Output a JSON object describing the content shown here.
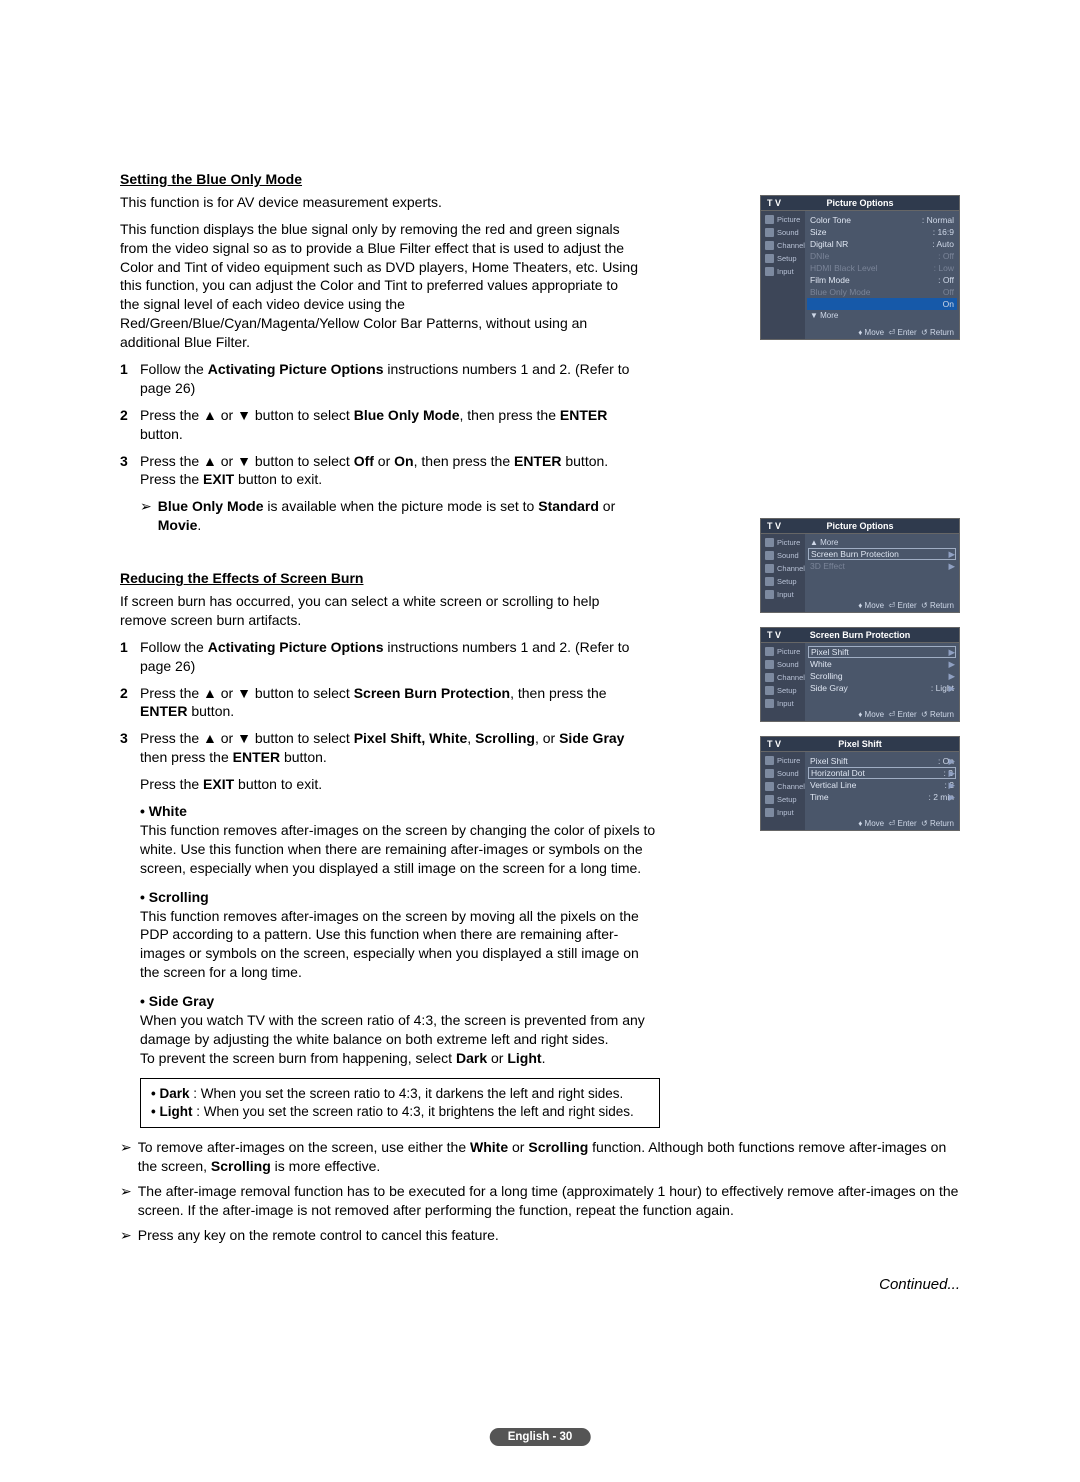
{
  "section1": {
    "title": "Setting the Blue Only Mode",
    "intro1": "This function is for AV device measurement experts.",
    "intro2": "This function displays the blue signal only by removing the red and green signals from the video signal so as to provide a Blue Filter effect that is used to adjust the Color and Tint of video equipment such as DVD players, Home Theaters, etc. Using this function, you can adjust the Color and Tint to preferred values appropriate to the signal level of each video device using the Red/Green/Blue/Cyan/Magenta/Yellow Color Bar Patterns, without using an additional Blue Filter.",
    "step1_a": "Follow the ",
    "step1_bold": "Activating Picture Options",
    "step1_b": " instructions numbers 1 and 2. (Refer to page 26)",
    "step2_a": "Press the ▲ or ▼ button to select ",
    "step2_bold1": "Blue Only Mode",
    "step2_b": ", then press the ",
    "step2_bold2": "ENTER",
    "step2_c": " button.",
    "step3_a": "Press the ▲ or ▼ button to select ",
    "step3_bold1": "Off",
    "step3_b": " or ",
    "step3_bold2": "On",
    "step3_c": ", then press the ",
    "step3_bold3": "ENTER",
    "step3_d": " button. Press the ",
    "step3_bold4": "EXIT",
    "step3_e": " button to exit.",
    "note_bold": "Blue Only Mode",
    "note_a": " is available when the picture mode is set to ",
    "note_bold2": "Standard",
    "note_b": " or ",
    "note_bold3": "Movie",
    "note_c": "."
  },
  "section2": {
    "title": "Reducing the Effects of Screen Burn",
    "intro": "If screen burn has occurred, you can select a white screen or scrolling to help remove screen burn artifacts.",
    "step1_a": "Follow the ",
    "step1_bold": "Activating Picture Options",
    "step1_b": " instructions numbers 1 and 2. (Refer to page 26)",
    "step2_a": "Press the ▲ or ▼ button to select ",
    "step2_bold1": "Screen Burn Protection",
    "step2_b": ", then press the ",
    "step2_bold2": "ENTER",
    "step2_c": " button.",
    "step3_a": "Press the ▲ or ▼ button to select ",
    "step3_bold1": "Pixel Shift, White",
    "step3_b": ", ",
    "step3_bold2": "Scrolling",
    "step3_c": ", or ",
    "step3_bold3": "Side Gray",
    "step3_d": " then press the ",
    "step3_bold4": "ENTER",
    "step3_e": " button.",
    "exit_a": "Press the ",
    "exit_bold": "EXIT",
    "exit_b": " button to exit.",
    "white_title": "• White",
    "white_body": "This function removes after-images on the screen by changing the color of pixels to white. Use this function when there are remaining after-images or symbols on the screen, especially when you displayed a still image on the screen for a long time.",
    "scroll_title": "• Scrolling",
    "scroll_body": "This function removes after-images on the screen by moving all the pixels on the PDP according to a pattern. Use this function when there are remaining after-images or symbols on the screen, especially when you displayed a still image on the screen for a long time.",
    "side_title": "• Side Gray",
    "side_body_a": "When you watch TV with the screen ratio of 4:3, the screen is prevented from any damage by adjusting the white balance on both extreme left and right sides.",
    "side_body_b_a": "To prevent the screen burn from happening, select ",
    "side_body_b_bold1": "Dark",
    "side_body_b_b": " or ",
    "side_body_b_bold2": "Light",
    "side_body_b_c": ".",
    "box1_bold": "• Dark",
    "box1_rest": " : When you set the screen ratio to 4:3, it darkens the left and right sides.",
    "box2_bold": "• Light",
    "box2_rest": " : When you set the screen ratio to 4:3, it brightens the left and right sides.",
    "tail1_a": "To remove after-images on the screen, use either the ",
    "tail1_bold1": "White",
    "tail1_b": " or ",
    "tail1_bold2": "Scrolling",
    "tail1_c": " function. Although both functions remove after-images on the screen, ",
    "tail1_bold3": "Scrolling",
    "tail1_d": " is more effective.",
    "tail2": "The after-image removal function has to be executed for a long time (approximately 1 hour) to effectively remove after-images on the screen. If the after-image is not removed after performing the function, repeat the function again.",
    "tail3": "Press any key on the remote control to cancel this feature."
  },
  "continued": "Continued...",
  "footer": "English - 30",
  "osd": {
    "tv": "T V",
    "move": "Move",
    "enter": "Enter",
    "return": "Return",
    "side": {
      "picture": "Picture",
      "sound": "Sound",
      "channel": "Channel",
      "setup": "Setup",
      "input": "Input"
    },
    "menu1": {
      "title": "Picture Options",
      "rows": [
        {
          "lab": "Color Tone",
          "val": ": Normal"
        },
        {
          "lab": "Size",
          "val": ": 16:9"
        },
        {
          "lab": "Digital NR",
          "val": ": Auto"
        },
        {
          "lab": "DNIe",
          "val": ": Off",
          "dim": true
        },
        {
          "lab": "HDMI Black Level",
          "val": ": Low",
          "dim": true
        },
        {
          "lab": "Film Mode",
          "val": ": Off"
        },
        {
          "lab": "Blue Only Mode",
          "val": "Off",
          "dim": true
        }
      ],
      "hl": "On",
      "more": "▼  More"
    },
    "menu2": {
      "title": "Picture Options",
      "more": "▲  More",
      "rows": [
        {
          "lab": "Screen Burn Protection",
          "box": true
        },
        {
          "lab": "3D Effect",
          "dim": true
        }
      ]
    },
    "menu3": {
      "title": "Screen Burn Protection",
      "rows": [
        {
          "lab": "Pixel Shift",
          "box": true
        },
        {
          "lab": "White"
        },
        {
          "lab": "Scrolling"
        },
        {
          "lab": "Side Gray",
          "val": ": Light"
        }
      ]
    },
    "menu4": {
      "title": "Pixel Shift",
      "rows": [
        {
          "lab": "Pixel Shift",
          "val": ": On"
        },
        {
          "lab": "Horizontal Dot",
          "val": ": 2",
          "box": true
        },
        {
          "lab": "Vertical Line",
          "val": ": 2"
        },
        {
          "lab": "Time",
          "val": ": 2 min"
        }
      ]
    }
  }
}
